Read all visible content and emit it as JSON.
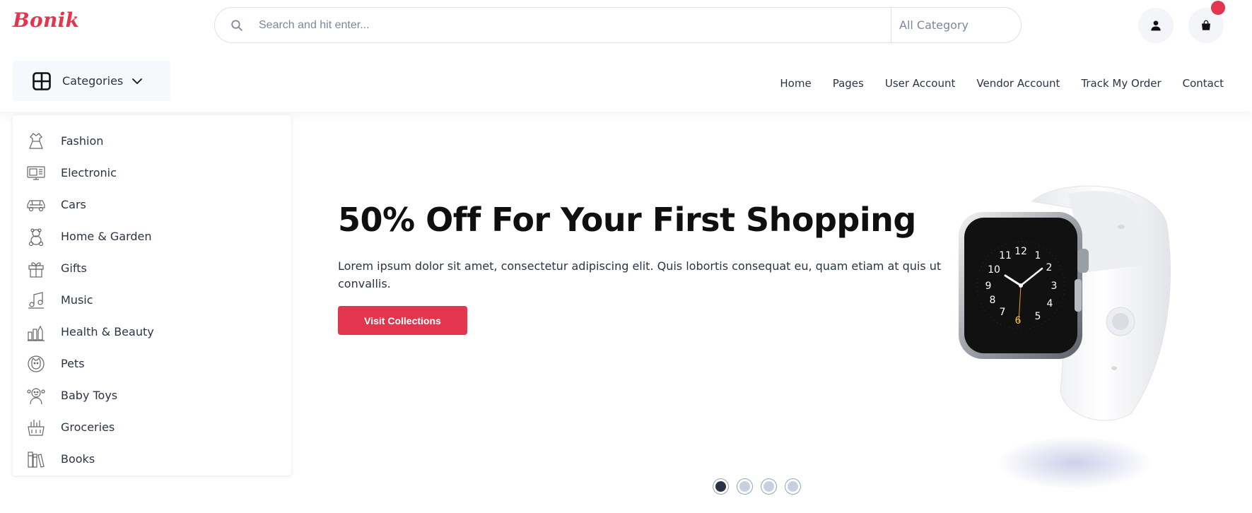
{
  "brand": {
    "logo_text": "Bonik",
    "accent_color": "#e3364e"
  },
  "search": {
    "placeholder": "Search and hit enter...",
    "category_label": "All Category",
    "icon": "search-icon"
  },
  "header_icons": {
    "user": "user-icon",
    "cart": "shopping-bag-icon",
    "cart_badge": ""
  },
  "categories_button": {
    "label": "Categories",
    "icon": "grid-icon",
    "chevron": "chevron-down-icon"
  },
  "nav": {
    "items": [
      "Home",
      "Pages",
      "User Account",
      "Vendor Account",
      "Track My Order",
      "Contact"
    ]
  },
  "category_menu": {
    "items": [
      {
        "label": "Fashion",
        "icon": "dress-icon"
      },
      {
        "label": "Electronic",
        "icon": "monitor-icon"
      },
      {
        "label": "Cars",
        "icon": "car-icon"
      },
      {
        "label": "Home & Garden",
        "icon": "teddy-bear-icon"
      },
      {
        "label": "Gifts",
        "icon": "gift-icon"
      },
      {
        "label": "Music",
        "icon": "music-icon"
      },
      {
        "label": "Health & Beauty",
        "icon": "cosmetics-icon"
      },
      {
        "label": "Pets",
        "icon": "pet-icon"
      },
      {
        "label": "Baby Toys",
        "icon": "baby-icon"
      },
      {
        "label": "Groceries",
        "icon": "grocery-basket-icon"
      },
      {
        "label": "Books",
        "icon": "books-icon"
      }
    ]
  },
  "hero": {
    "title": "50% Off For Your First Shopping",
    "description": "Lorem ipsum dolor sit amet, consectetur adipiscing elit. Quis lobortis consequat eu, quam etiam at quis ut convallis.",
    "button_label": "Visit Collections",
    "image": "smartwatch-image"
  },
  "carousel": {
    "total_slides": 4,
    "active_slide": 1
  }
}
